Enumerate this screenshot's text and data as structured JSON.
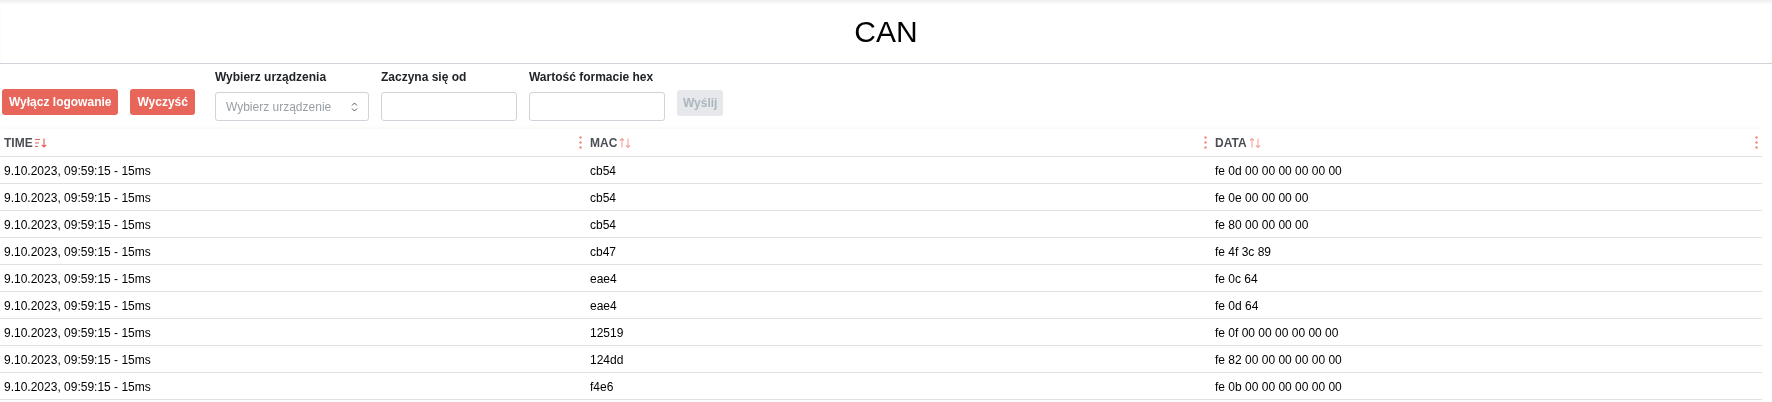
{
  "title": "CAN",
  "controls": {
    "buttons": [
      {
        "label": "Wyłącz logowanie"
      },
      {
        "label": "Wyczyść"
      }
    ],
    "device": {
      "label": "Wybierz urządzenia",
      "placeholder": "Wybierz urządzenie"
    },
    "start": {
      "label": "Zaczyna się od"
    },
    "hex": {
      "label": "Wartość formacie hex"
    },
    "send": {
      "label": "Wyślij",
      "disabled": true
    }
  },
  "table": {
    "columns": [
      {
        "label": "TIME",
        "sorted": true
      },
      {
        "label": "MAC",
        "sorted": false
      },
      {
        "label": "DATA",
        "sorted": false
      }
    ],
    "rows": [
      [
        "9.10.2023, 09:59:15 - 15ms",
        "cb54",
        "fe 0d 00 00 00 00 00 00"
      ],
      [
        "9.10.2023, 09:59:15 - 15ms",
        "cb54",
        "fe 0e 00 00 00 00"
      ],
      [
        "9.10.2023, 09:59:15 - 15ms",
        "cb54",
        "fe 80 00 00 00 00"
      ],
      [
        "9.10.2023, 09:59:15 - 15ms",
        "cb47",
        "fe 4f 3c 89"
      ],
      [
        "9.10.2023, 09:59:15 - 15ms",
        "eae4",
        "fe 0c 64"
      ],
      [
        "9.10.2023, 09:59:15 - 15ms",
        "eae4",
        "fe 0d 64"
      ],
      [
        "9.10.2023, 09:59:15 - 15ms",
        "12519",
        "fe 0f 00 00 00 00 00 00"
      ],
      [
        "9.10.2023, 09:59:15 - 15ms",
        "124dd",
        "fe 82 00 00 00 00 00 00"
      ],
      [
        "9.10.2023, 09:59:15 - 15ms",
        "f4e6",
        "fe 0b 00 00 00 00 00 00"
      ]
    ]
  }
}
